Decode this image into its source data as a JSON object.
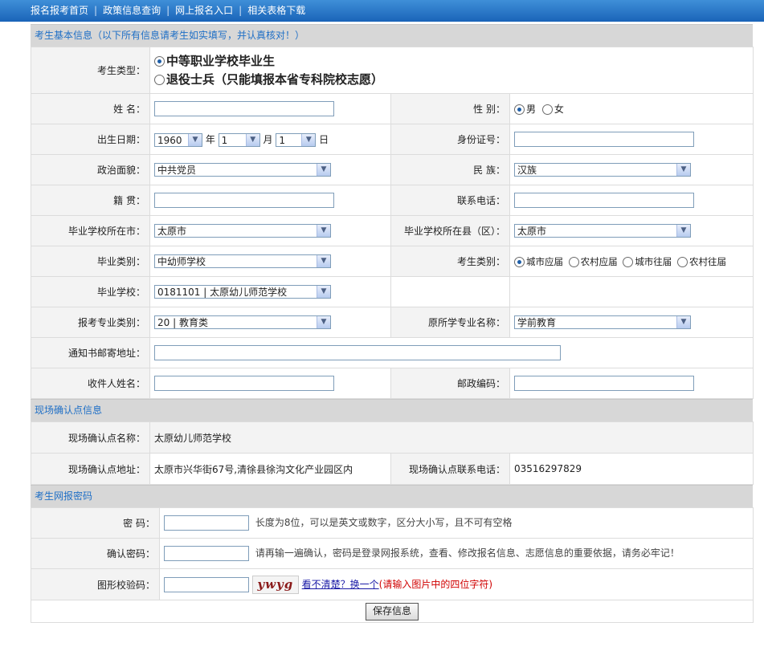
{
  "nav": {
    "items": [
      "报名报考首页",
      "政策信息查询",
      "网上报名入口",
      "相关表格下载"
    ],
    "separator": "|"
  },
  "section1": {
    "title": "考生基本信息（以下所有信息请考生如实填写，并认真核对！）",
    "candidate_type_label": "考生类型：",
    "candidate_type_options": [
      "中等职业学校毕业生",
      "退役士兵（只能填报本省专科院校志愿）"
    ],
    "name_label": "姓 名：",
    "gender_label": "性 别：",
    "gender_options": [
      "男",
      "女"
    ],
    "birth_label": "出生日期：",
    "birth_year": "1960",
    "birth_year_unit": "年",
    "birth_month": "1",
    "birth_month_unit": "月",
    "birth_day": "1",
    "birth_day_unit": "日",
    "id_label": "身份证号：",
    "politics_label": "政治面貌：",
    "politics_value": "中共党员",
    "ethnicity_label": "民 族：",
    "ethnicity_value": "汉族",
    "native_label": "籍 贯：",
    "phone_label": "联系电话：",
    "school_city_label": "毕业学校所在市：",
    "school_city_value": "太原市",
    "school_county_label": "毕业学校所在县（区）：",
    "school_county_value": "太原市",
    "grad_category_label": "毕业类别：",
    "grad_category_value": "中幼师学校",
    "exam_category_label": "考生类别：",
    "exam_category_options": [
      "城市应届",
      "农村应届",
      "城市往届",
      "农村往届"
    ],
    "school_label": "毕业学校：",
    "school_value": "0181101 | 太原幼儿师范学校",
    "major_category_label": "报考专业类别：",
    "major_category_value": "20 | 教育类",
    "orig_major_label": "原所学专业名称：",
    "orig_major_value": "学前教育",
    "mail_address_label": "通知书邮寄地址：",
    "recipient_label": "收件人姓名：",
    "postcode_label": "邮政编码："
  },
  "section2": {
    "title": "现场确认点信息",
    "site_name_label": "现场确认点名称：",
    "site_name_value": "太原幼儿师范学校",
    "site_address_label": "现场确认点地址：",
    "site_address_value": "太原市兴华街67号,清徐县徐沟文化产业园区内",
    "site_phone_label": "现场确认点联系电话：",
    "site_phone_value": "03516297829"
  },
  "section3": {
    "title": "考生网报密码",
    "password_label": "密 码：",
    "password_hint": "长度为8位，可以是英文或数字，区分大小写，且不可有空格",
    "confirm_label": "确认密码：",
    "confirm_hint": "请再输一遍确认，密码是登录网报系统，查看、修改报名信息、志愿信息的重要依据，请务必牢记！",
    "captcha_label": "图形校验码：",
    "captcha_text": "ywyg",
    "captcha_link": "看不清楚？换一个",
    "captcha_hint": "(请输入图片中的四位字符)"
  },
  "save_label": "保存信息"
}
